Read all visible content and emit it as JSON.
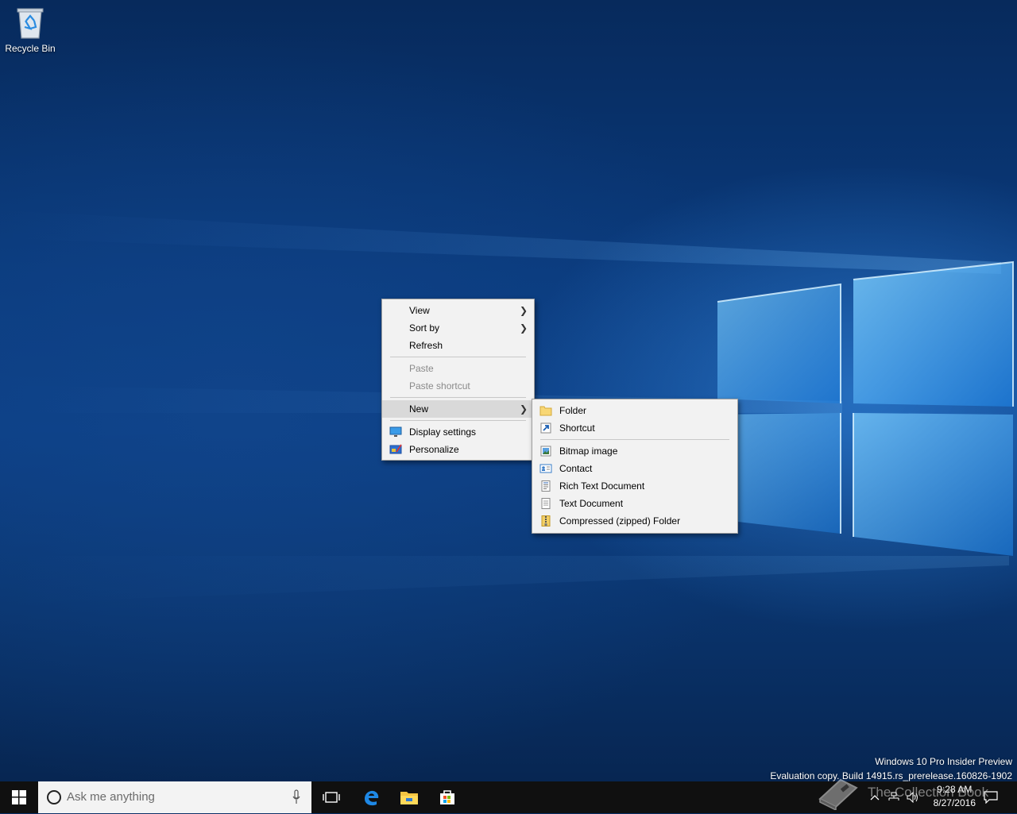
{
  "desktop": {
    "recycle_bin_label": "Recycle Bin"
  },
  "context_menu": {
    "items": [
      {
        "label": "View",
        "submenu": true
      },
      {
        "label": "Sort by",
        "submenu": true
      },
      {
        "label": "Refresh"
      },
      {
        "label": "Paste",
        "disabled": true
      },
      {
        "label": "Paste shortcut",
        "disabled": true
      },
      {
        "label": "New",
        "submenu": true,
        "highlighted": true
      },
      {
        "label": "Display settings",
        "icon": "display-settings-icon"
      },
      {
        "label": "Personalize",
        "icon": "personalize-icon"
      }
    ]
  },
  "new_submenu": {
    "items": [
      {
        "label": "Folder",
        "icon": "folder-icon"
      },
      {
        "label": "Shortcut",
        "icon": "shortcut-icon"
      },
      {
        "label": "Bitmap image",
        "icon": "bitmap-icon"
      },
      {
        "label": "Contact",
        "icon": "contact-icon"
      },
      {
        "label": "Rich Text Document",
        "icon": "rich-text-icon"
      },
      {
        "label": "Text Document",
        "icon": "text-document-icon"
      },
      {
        "label": "Compressed (zipped) Folder",
        "icon": "zip-folder-icon"
      }
    ]
  },
  "watermark": {
    "line1": "Windows 10 Pro Insider Preview",
    "line2": "Evaluation copy. Build 14915.rs_prerelease.160826-1902"
  },
  "taskbar": {
    "search_placeholder": "Ask me anything",
    "clock_time": "9:28 AM",
    "clock_date": "8/27/2016",
    "overlay_text": "The Collection Book"
  },
  "colors": {
    "accent": "#0078d7",
    "taskbar": "#101010",
    "menu_bg": "#f2f2f2"
  }
}
